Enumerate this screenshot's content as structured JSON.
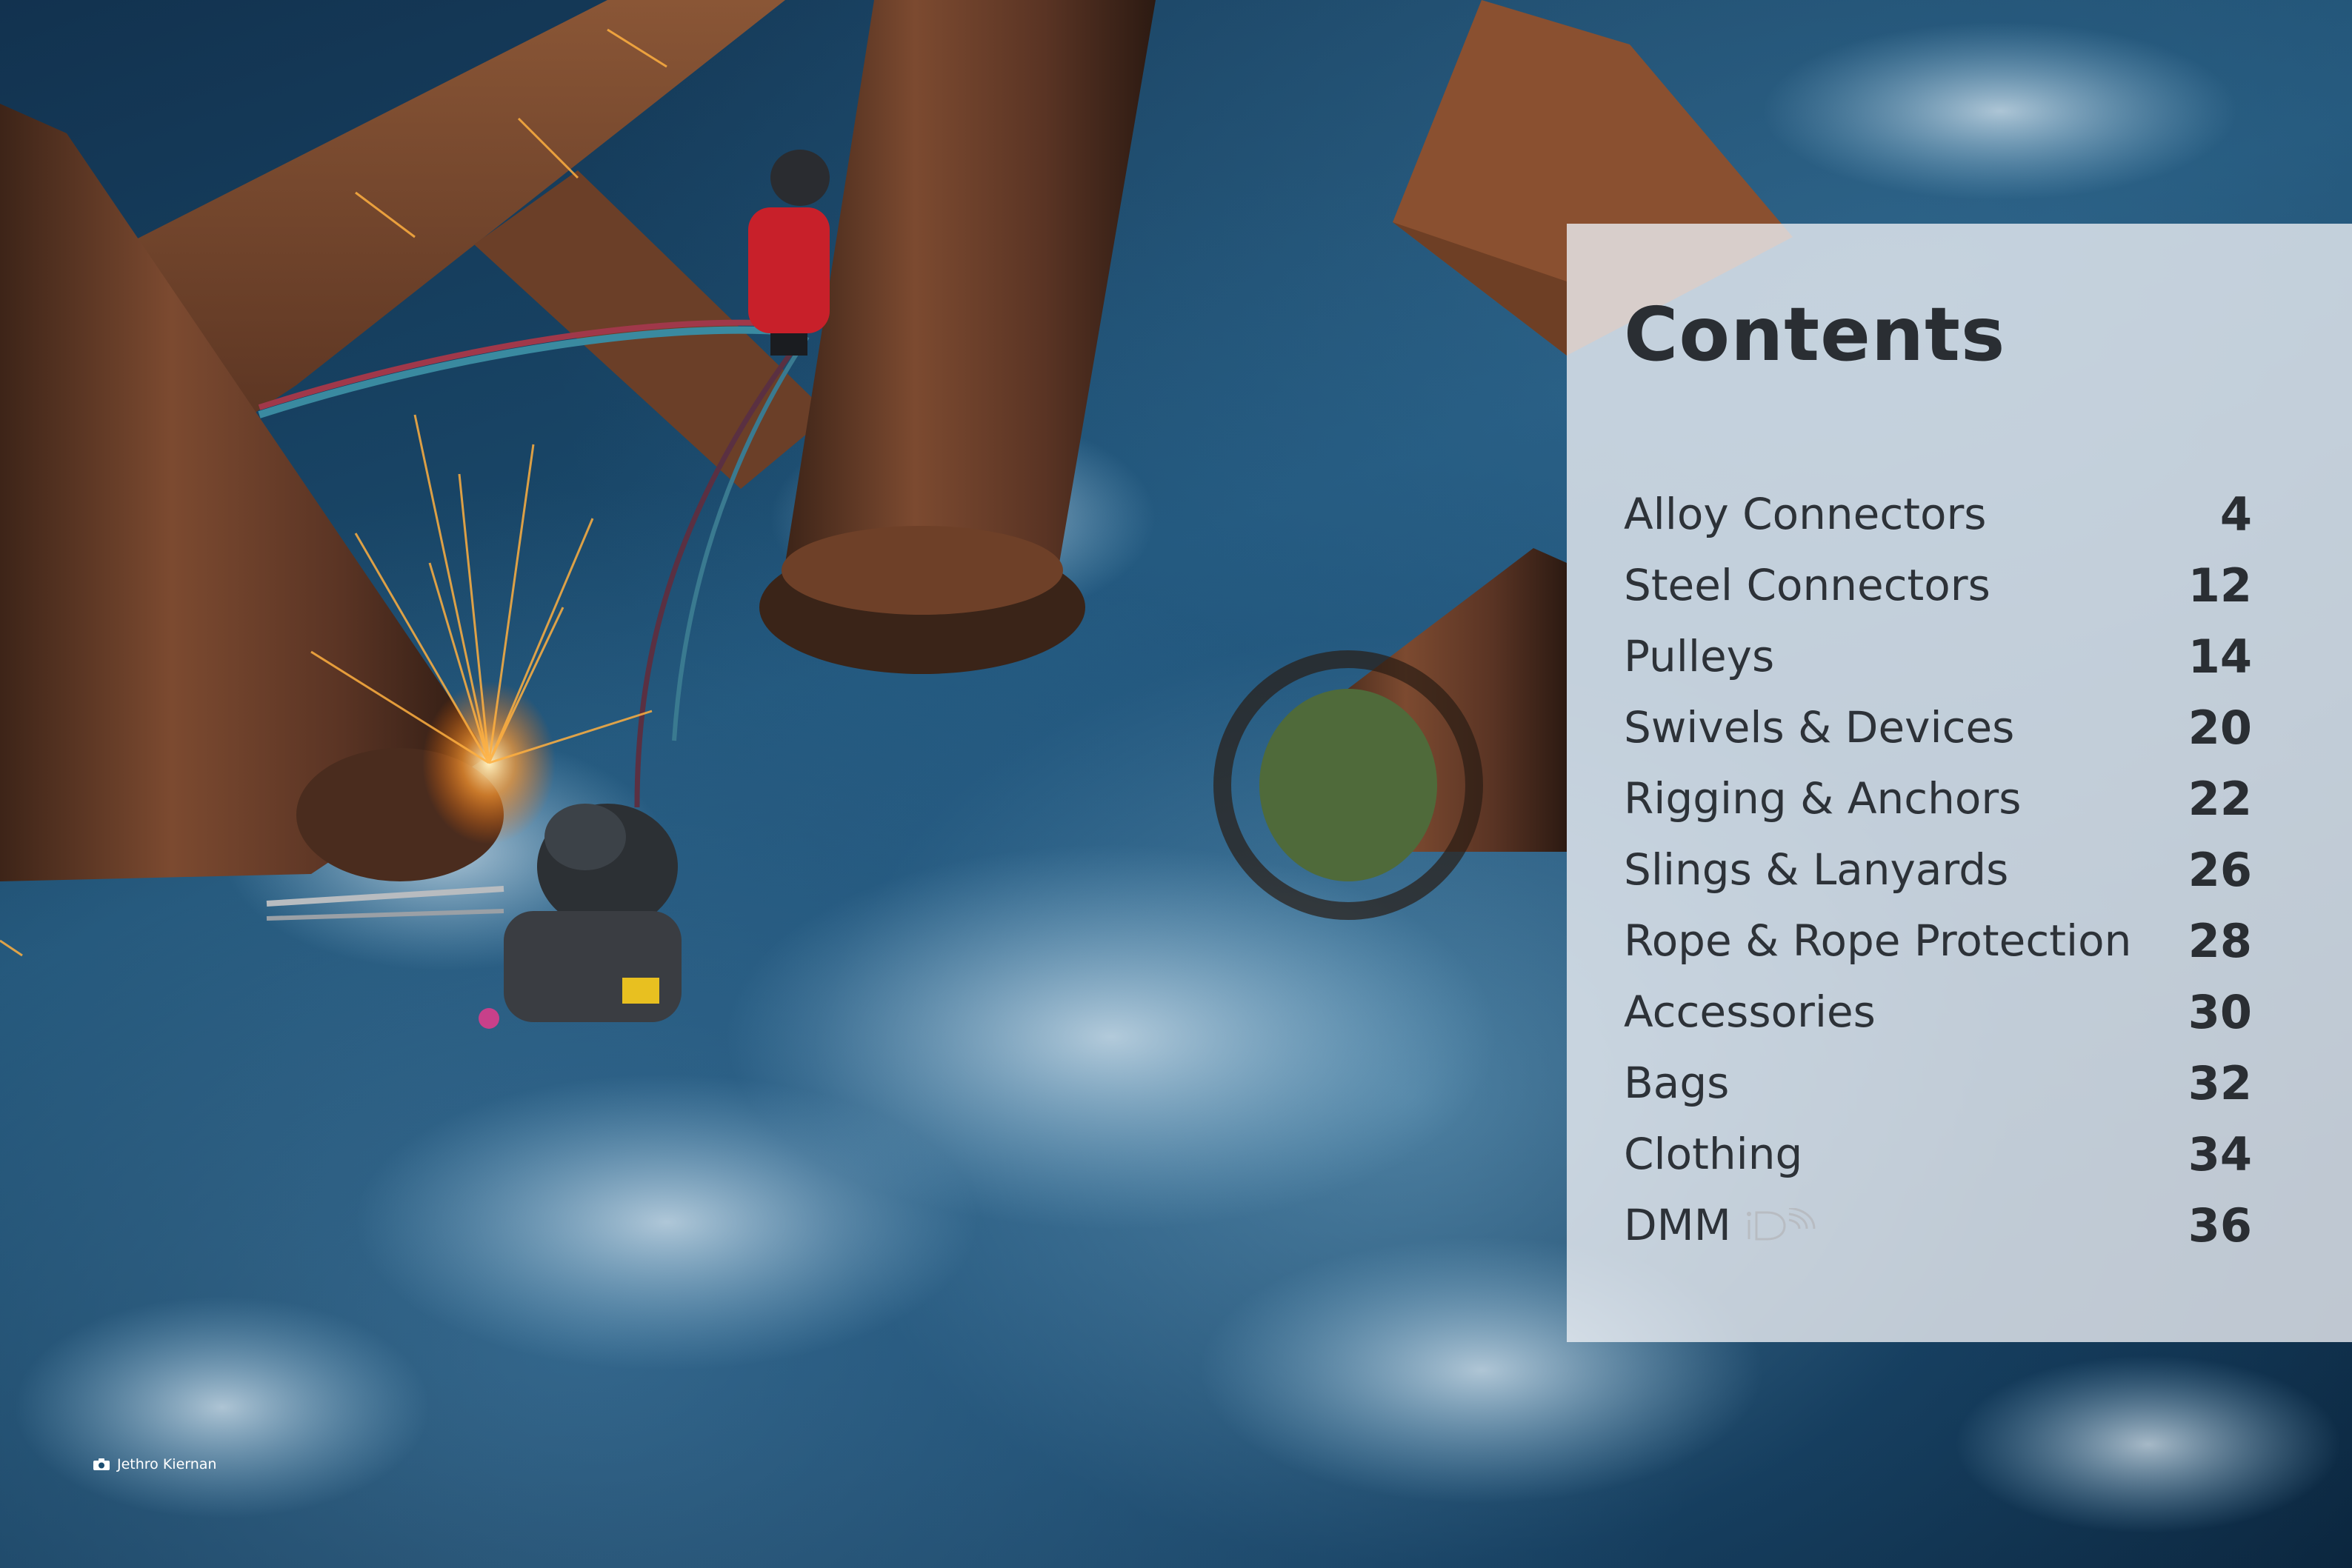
{
  "contents": {
    "title": "Contents",
    "items": [
      {
        "label": "Alloy Connectors",
        "page": "4"
      },
      {
        "label": "Steel Connectors",
        "page": "12"
      },
      {
        "label": "Pulleys",
        "page": "14"
      },
      {
        "label": "Swivels & Devices",
        "page": "20"
      },
      {
        "label": "Rigging & Anchors",
        "page": "22"
      },
      {
        "label": "Slings & Lanyards",
        "page": "26"
      },
      {
        "label": "Rope & Rope Protection",
        "page": "28"
      },
      {
        "label": "Accessories",
        "page": "30"
      },
      {
        "label": "Bags",
        "page": "32"
      },
      {
        "label": "Clothing",
        "page": "34"
      },
      {
        "label": "DMM",
        "page": "36",
        "logo": "iD",
        "icon": "dmm-id-logo-icon"
      }
    ]
  },
  "photo_credit": {
    "icon": "camera-icon",
    "name": "Jethro Kiernan"
  },
  "colors": {
    "panel": "#ebeef2",
    "text": "#2a2e33",
    "rust": "#7a4a2e",
    "sea": "#1b4d70"
  }
}
